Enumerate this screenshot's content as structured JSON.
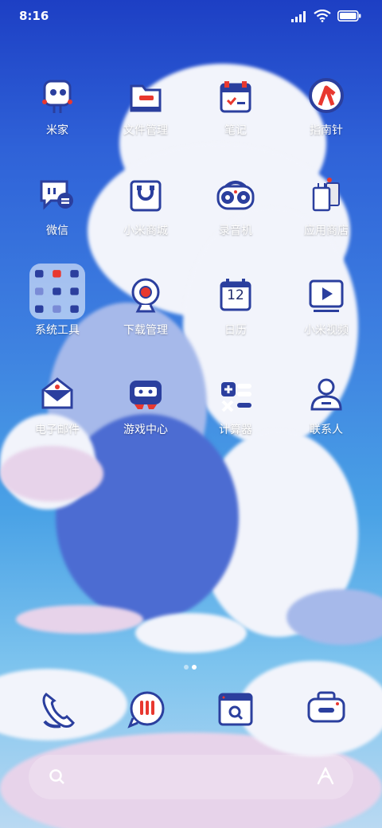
{
  "status_bar": {
    "time": "8:16"
  },
  "apps": [
    {
      "label": "米家",
      "icon": "mijia-robot-icon"
    },
    {
      "label": "文件管理",
      "icon": "folder-icon"
    },
    {
      "label": "笔记",
      "icon": "notes-icon"
    },
    {
      "label": "指南针",
      "icon": "compass-icon"
    },
    {
      "label": "微信",
      "icon": "chat-bubble-icon"
    },
    {
      "label": "小米商城",
      "icon": "shopping-bag-icon"
    },
    {
      "label": "录音机",
      "icon": "recorder-icon"
    },
    {
      "label": "应用商店",
      "icon": "app-store-bags-icon"
    },
    {
      "label": "系统工具",
      "icon": "folder-grid-icon"
    },
    {
      "label": "下载管理",
      "icon": "download-camera-icon"
    },
    {
      "label": "日历",
      "icon": "calendar-icon",
      "day": "12"
    },
    {
      "label": "小米视频",
      "icon": "video-play-icon"
    },
    {
      "label": "电子邮件",
      "icon": "mail-envelope-icon"
    },
    {
      "label": "游戏中心",
      "icon": "game-controller-icon"
    },
    {
      "label": "计算器",
      "icon": "calculator-icon"
    },
    {
      "label": "联系人",
      "icon": "contact-person-icon"
    }
  ],
  "dock": [
    {
      "name": "phone",
      "icon": "phone-icon"
    },
    {
      "name": "messages",
      "icon": "message-bubble-icon"
    },
    {
      "name": "browser",
      "icon": "browser-search-icon"
    },
    {
      "name": "camera",
      "icon": "camera-icon"
    }
  ],
  "page_indicator": {
    "pages": 2,
    "current": 2
  },
  "colors": {
    "accent_blue": "#2b3f9e",
    "accent_red": "#e8382f",
    "accent_navy": "#1f2a6b"
  }
}
